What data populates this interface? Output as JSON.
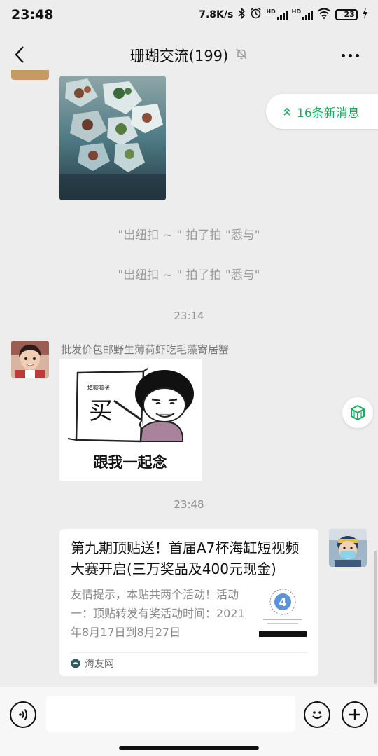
{
  "status_bar": {
    "time": "23:48",
    "net_speed": "7.8K/s",
    "battery": "23"
  },
  "header": {
    "title": "珊瑚交流(199)"
  },
  "new_messages_label": "16条新消息",
  "messages": {
    "system_1": "\"出纽扣 ~ \" 拍了拍 \"悉与\"",
    "system_2": "\"出纽扣 ~ \" 拍了拍 \"悉与\"",
    "time_1": "23:14",
    "sender_name": "批发价包邮野生薄荷虾吃毛藻寄居蟹",
    "sticker_sign": "买",
    "sticker_small": "填嘘嘘买",
    "sticker_caption": "跟我一起念",
    "time_2": "23:48"
  },
  "link_card": {
    "title": "第九期顶贴送！首届A7杯海缸短视频大赛开启(三万奖品及400元现金)",
    "description": "友情提示，本贴共两个活动！活动一：顶贴转发有奖活动时间：2021年8月17日到8月27日",
    "source": "海友网"
  },
  "colors": {
    "accent": "#1aad5b",
    "background": "#ededed"
  }
}
